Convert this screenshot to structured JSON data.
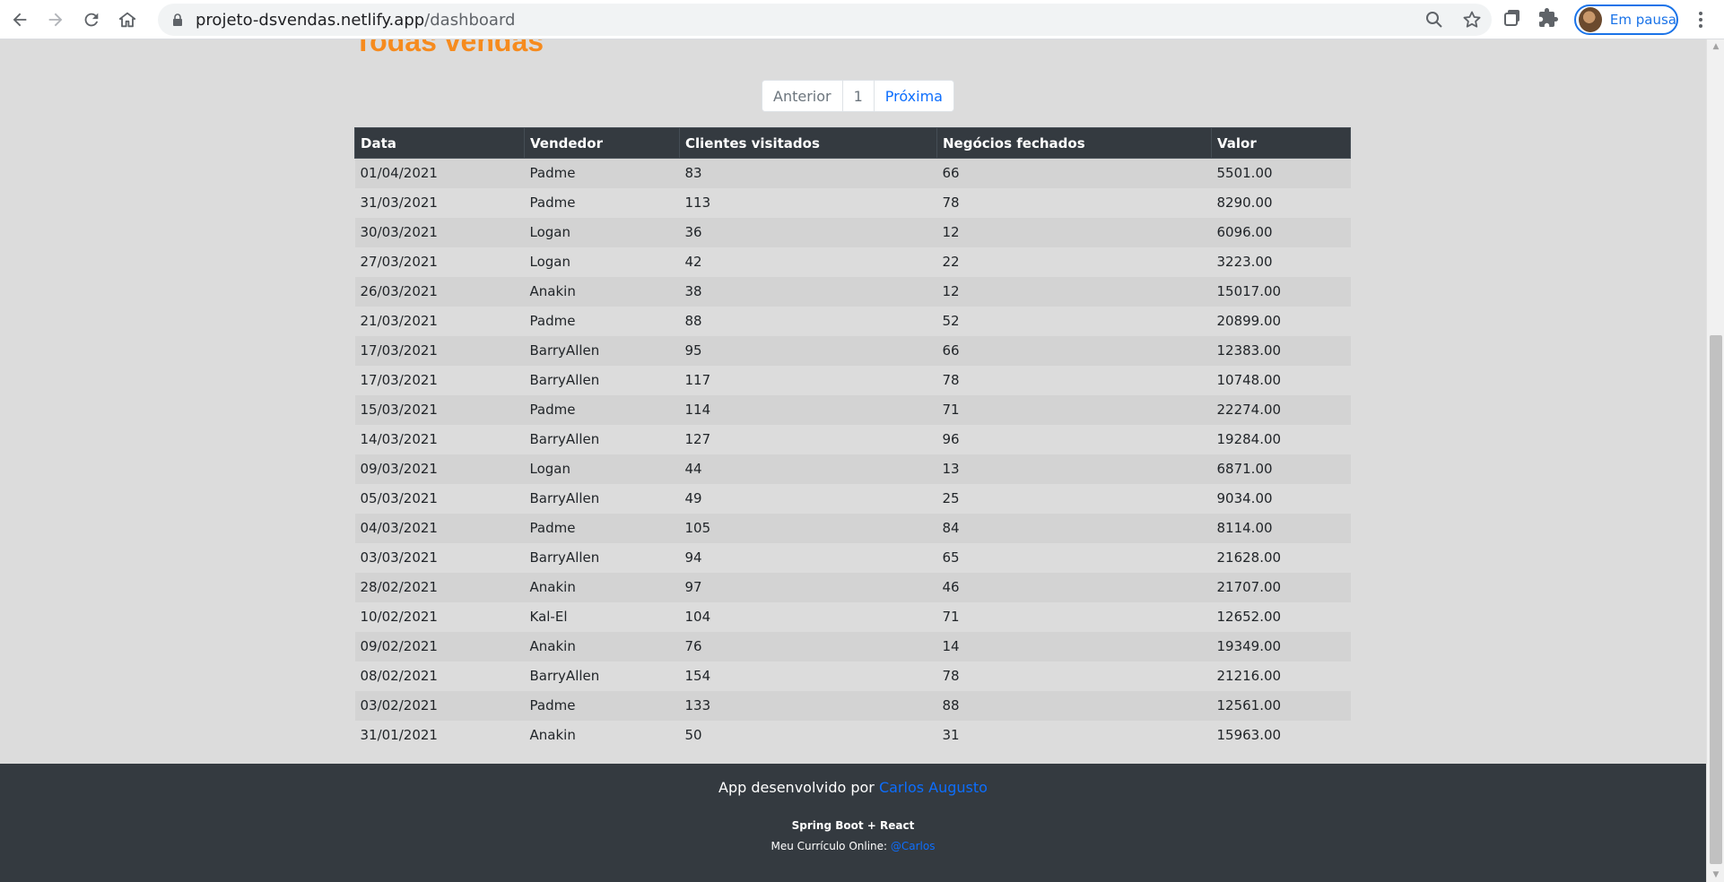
{
  "browser": {
    "url_host": "projeto-dsvendas.netlify.app",
    "url_path": "/dashboard",
    "profile_label": "Em pausa"
  },
  "page": {
    "title": "Todas vendas",
    "pagination": {
      "previous": "Anterior",
      "current": "1",
      "next": "Próxima"
    }
  },
  "table": {
    "headers": [
      "Data",
      "Vendedor",
      "Clientes visitados",
      "Negócios fechados",
      "Valor"
    ],
    "rows": [
      [
        "01/04/2021",
        "Padme",
        "83",
        "66",
        "5501.00"
      ],
      [
        "31/03/2021",
        "Padme",
        "113",
        "78",
        "8290.00"
      ],
      [
        "30/03/2021",
        "Logan",
        "36",
        "12",
        "6096.00"
      ],
      [
        "27/03/2021",
        "Logan",
        "42",
        "22",
        "3223.00"
      ],
      [
        "26/03/2021",
        "Anakin",
        "38",
        "12",
        "15017.00"
      ],
      [
        "21/03/2021",
        "Padme",
        "88",
        "52",
        "20899.00"
      ],
      [
        "17/03/2021",
        "BarryAllen",
        "95",
        "66",
        "12383.00"
      ],
      [
        "17/03/2021",
        "BarryAllen",
        "117",
        "78",
        "10748.00"
      ],
      [
        "15/03/2021",
        "Padme",
        "114",
        "71",
        "22274.00"
      ],
      [
        "14/03/2021",
        "BarryAllen",
        "127",
        "96",
        "19284.00"
      ],
      [
        "09/03/2021",
        "Logan",
        "44",
        "13",
        "6871.00"
      ],
      [
        "05/03/2021",
        "BarryAllen",
        "49",
        "25",
        "9034.00"
      ],
      [
        "04/03/2021",
        "Padme",
        "105",
        "84",
        "8114.00"
      ],
      [
        "03/03/2021",
        "BarryAllen",
        "94",
        "65",
        "21628.00"
      ],
      [
        "28/02/2021",
        "Anakin",
        "97",
        "46",
        "21707.00"
      ],
      [
        "10/02/2021",
        "Kal-El",
        "104",
        "71",
        "12652.00"
      ],
      [
        "09/02/2021",
        "Anakin",
        "76",
        "14",
        "19349.00"
      ],
      [
        "08/02/2021",
        "BarryAllen",
        "154",
        "78",
        "21216.00"
      ],
      [
        "03/02/2021",
        "Padme",
        "133",
        "88",
        "12561.00"
      ],
      [
        "31/01/2021",
        "Anakin",
        "50",
        "31",
        "15963.00"
      ]
    ]
  },
  "footer": {
    "line1_prefix": "App desenvolvido por ",
    "author_link": "Carlos Augusto",
    "line2": "Spring Boot + React",
    "line3_prefix": "Meu Currículo Online: ",
    "cv_link": "@Carlos"
  },
  "colors": {
    "accent_orange": "#f68b1e",
    "link_blue": "#0d6efd",
    "dark": "#343a40"
  },
  "icons": [
    "back-icon",
    "forward-icon",
    "reload-icon",
    "home-icon",
    "lock-icon",
    "zoom-icon",
    "star-icon",
    "tab-search-icon",
    "extensions-icon",
    "menu-icon"
  ]
}
